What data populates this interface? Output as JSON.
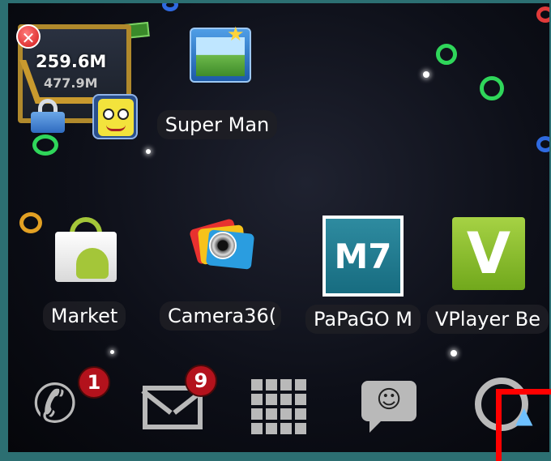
{
  "memory_widget": {
    "used": "259.6M",
    "total": "477.9M"
  },
  "apps": {
    "super_manager": "Super Man",
    "market": "Market",
    "camera360": "Camera36(",
    "papago": "PaPaGO M",
    "papago_icon_text": "M7",
    "vplayer": "VPlayer Be",
    "vplayer_icon_text": "V"
  },
  "dock": {
    "phone_badge": "1",
    "gmail_badge": "9",
    "sms_face": "☺"
  },
  "colors": {
    "badge": "#b3121c",
    "highlight": "#ff0000",
    "vplayer_green": "#8cc43a",
    "papago_teal": "#1f7d92"
  }
}
